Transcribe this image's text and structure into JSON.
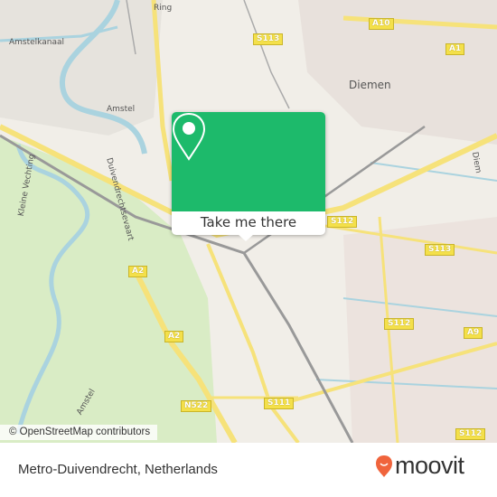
{
  "map": {
    "labels": {
      "amstelkanaal": "Amstelkanaal",
      "ring": "Ring",
      "amstel_north": "Amstel",
      "duivendrecht": "Duivendrechtsevaart",
      "kleine_vechting": "Kleine Vechting",
      "diemen": "Diemen",
      "amstel_south": "Amstel",
      "diem": "Diem"
    },
    "shields": [
      "S113",
      "A10",
      "A1",
      "S112",
      "S113",
      "A2",
      "S112",
      "A2",
      "A9",
      "S111",
      "N522",
      "S112"
    ],
    "colors": {
      "land": "#f1eee8",
      "green": "#d9ecc5",
      "water": "#aad3df",
      "road": "#f6e27a",
      "rail": "#999999"
    }
  },
  "popup": {
    "icon": "map-pin-icon",
    "button_label": "Take me there",
    "color": "#1dba6b"
  },
  "attribution": "© OpenStreetMap contributors",
  "footer": {
    "place": "Metro-Duivendrecht, Netherlands",
    "logo_text": "moovit",
    "logo_color": "#f0643c"
  }
}
